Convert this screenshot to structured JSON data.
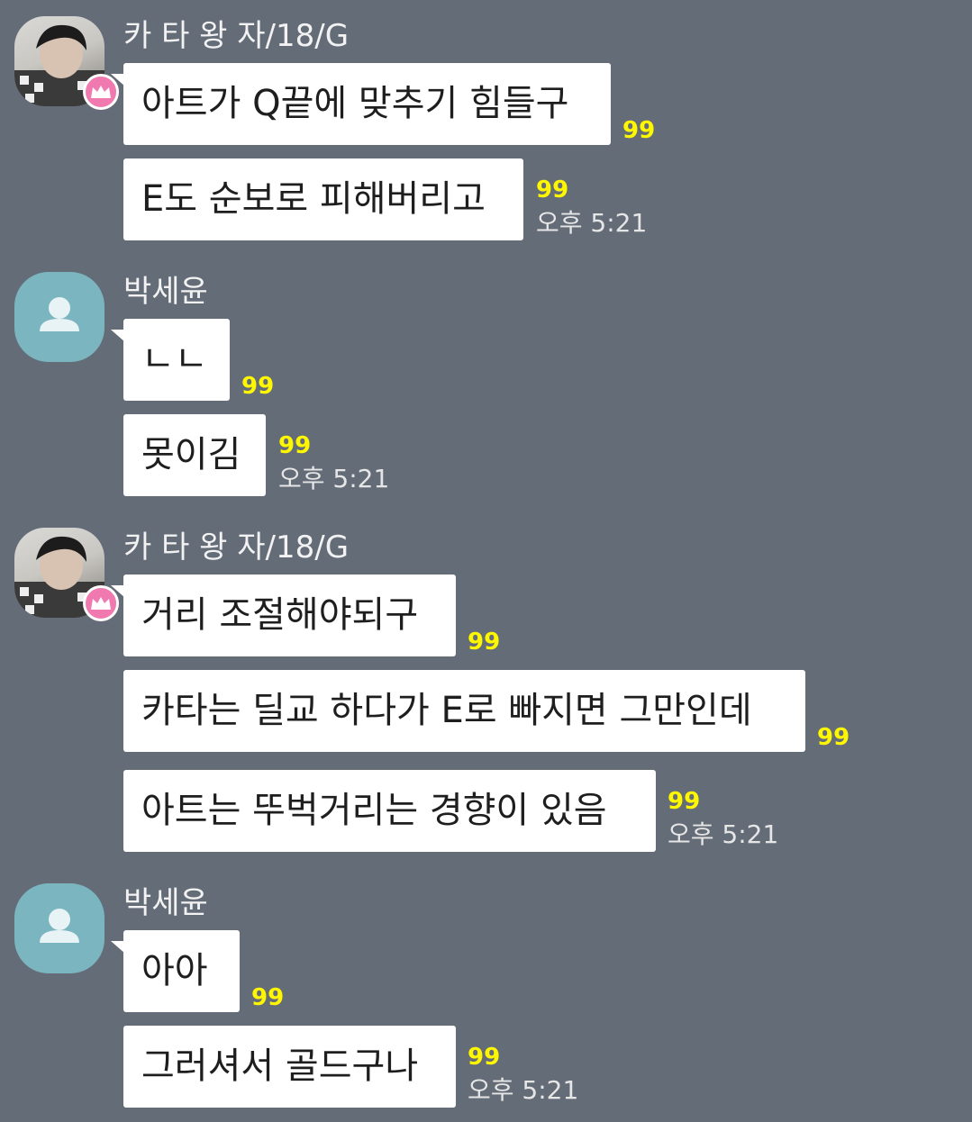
{
  "colors": {
    "background": "#646c78",
    "bubble": "#ffffff",
    "unread": "#fff700",
    "badge": "#f07ab0",
    "default_avatar": "#7bb5bf"
  },
  "groups": [
    {
      "sender": "카 타 왕 자/18/G",
      "avatar": "photo-with-crown-badge",
      "messages": [
        {
          "text": "아트가 Q끝에 맞추기 힘들구",
          "unread": "99"
        },
        {
          "text": "E도 순보로 피해버리고",
          "unread": "99",
          "time": "오후 5:21"
        }
      ]
    },
    {
      "sender": "박세윤",
      "avatar": "default-person-icon",
      "messages": [
        {
          "text": "ㄴㄴ",
          "unread": "99"
        },
        {
          "text": "못이김",
          "unread": "99",
          "time": "오후 5:21"
        }
      ]
    },
    {
      "sender": "카 타 왕 자/18/G",
      "avatar": "photo-with-crown-badge",
      "messages": [
        {
          "text": "거리 조절해야되구",
          "unread": "99"
        },
        {
          "text": "카타는 딜교 하다가 E로 빠지면 그만인데",
          "unread": "99"
        },
        {
          "text": "아트는 뚜벅거리는 경향이 있음",
          "unread": "99",
          "time": "오후 5:21"
        }
      ]
    },
    {
      "sender": "박세윤",
      "avatar": "default-person-icon",
      "messages": [
        {
          "text": "아아",
          "unread": "99"
        },
        {
          "text": "그러셔서 골드구나",
          "unread": "99",
          "time": "오후 5:21"
        }
      ]
    }
  ]
}
